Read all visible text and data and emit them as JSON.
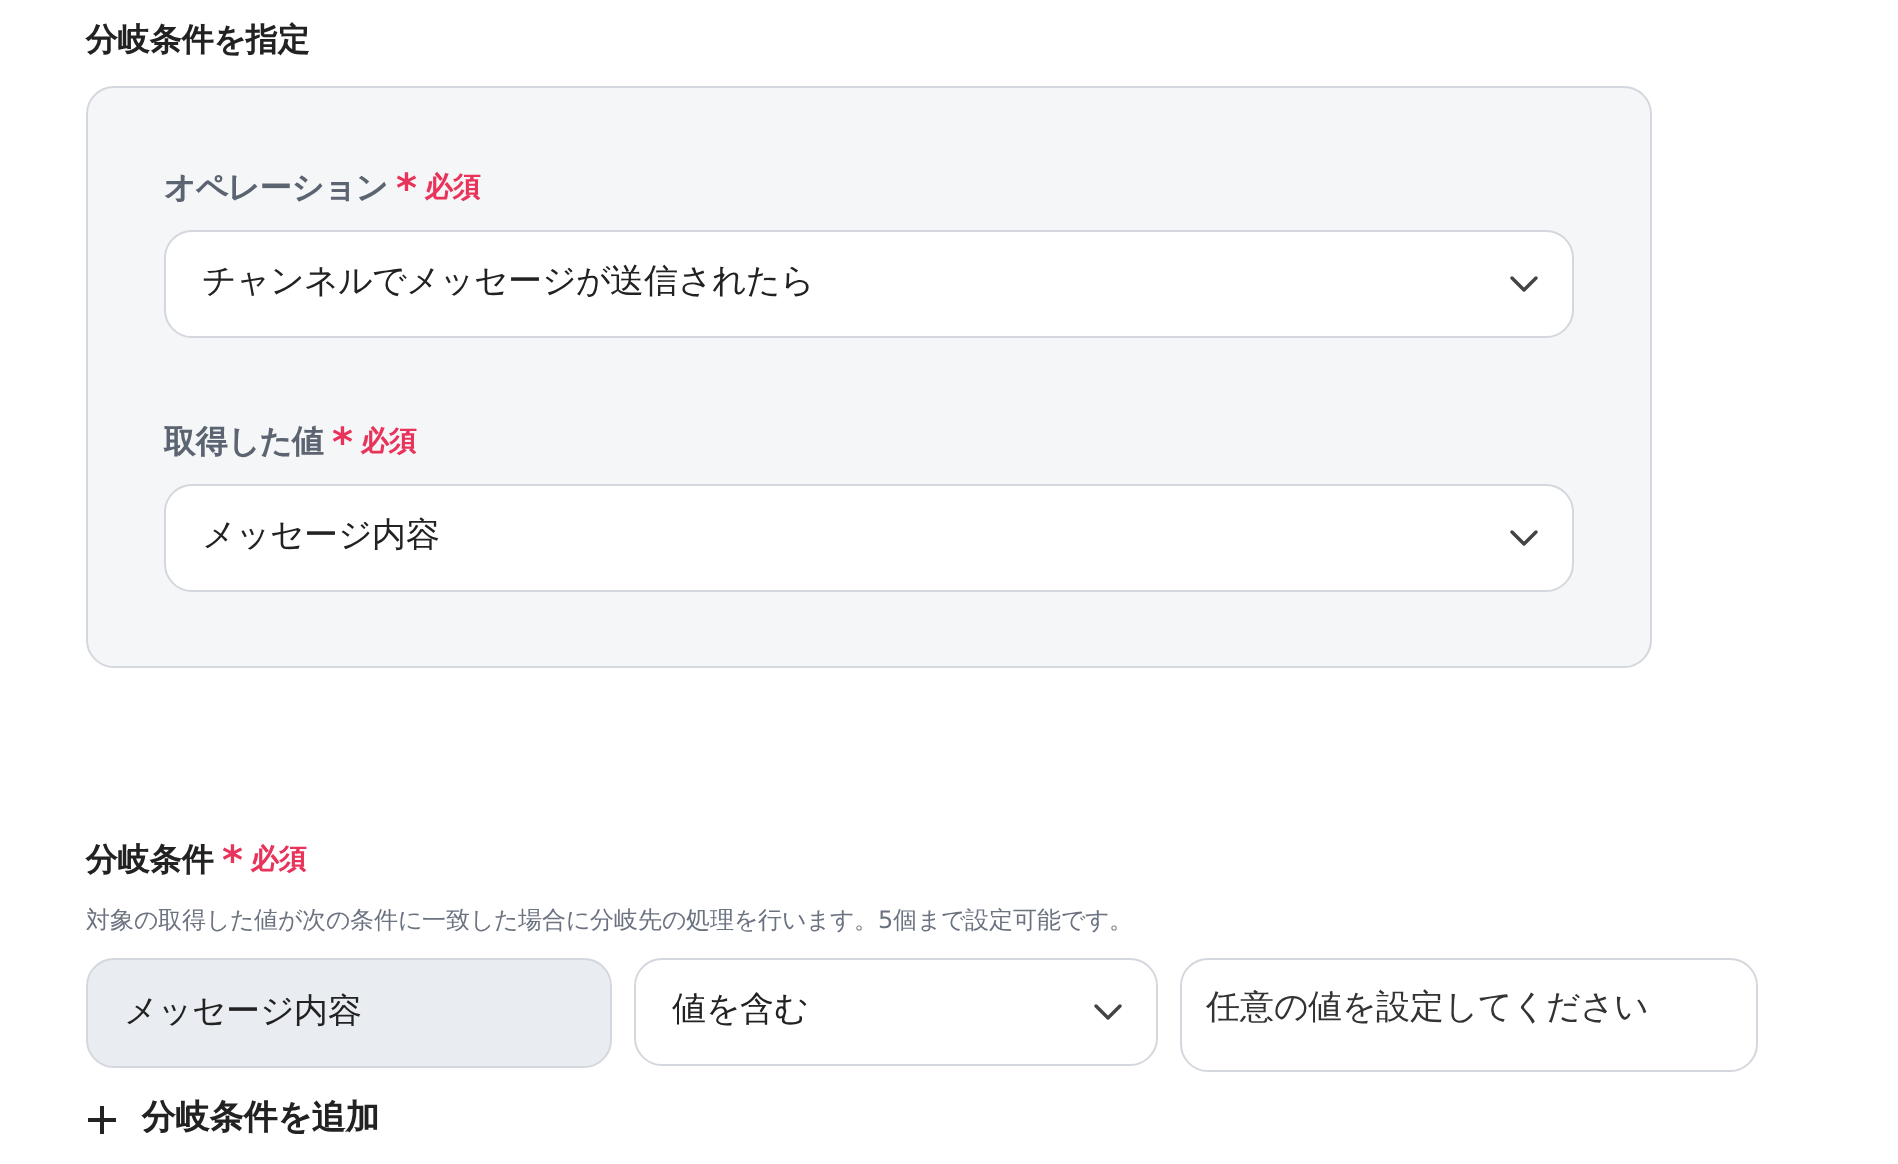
{
  "section_title": "分岐条件を指定",
  "source_card": {
    "fields": [
      {
        "label": "オペレーション",
        "required_mark": "*",
        "required_label": "必須",
        "value": "チャンネルでメッセージが送信されたら"
      },
      {
        "label": "取得した値",
        "required_mark": "*",
        "required_label": "必須",
        "value": "メッセージ内容"
      }
    ]
  },
  "conditions": {
    "label": "分岐条件",
    "required_mark": "*",
    "required_label": "必須",
    "description": "対象の取得した値が次の条件に一致した場合に分岐先の処理を行います。5個まで設定可能です。",
    "rows": [
      {
        "target": "メッセージ内容",
        "operator": "値を含む",
        "placeholder": "任意の値を設定してください"
      }
    ],
    "add_button": "分岐条件を追加"
  }
}
